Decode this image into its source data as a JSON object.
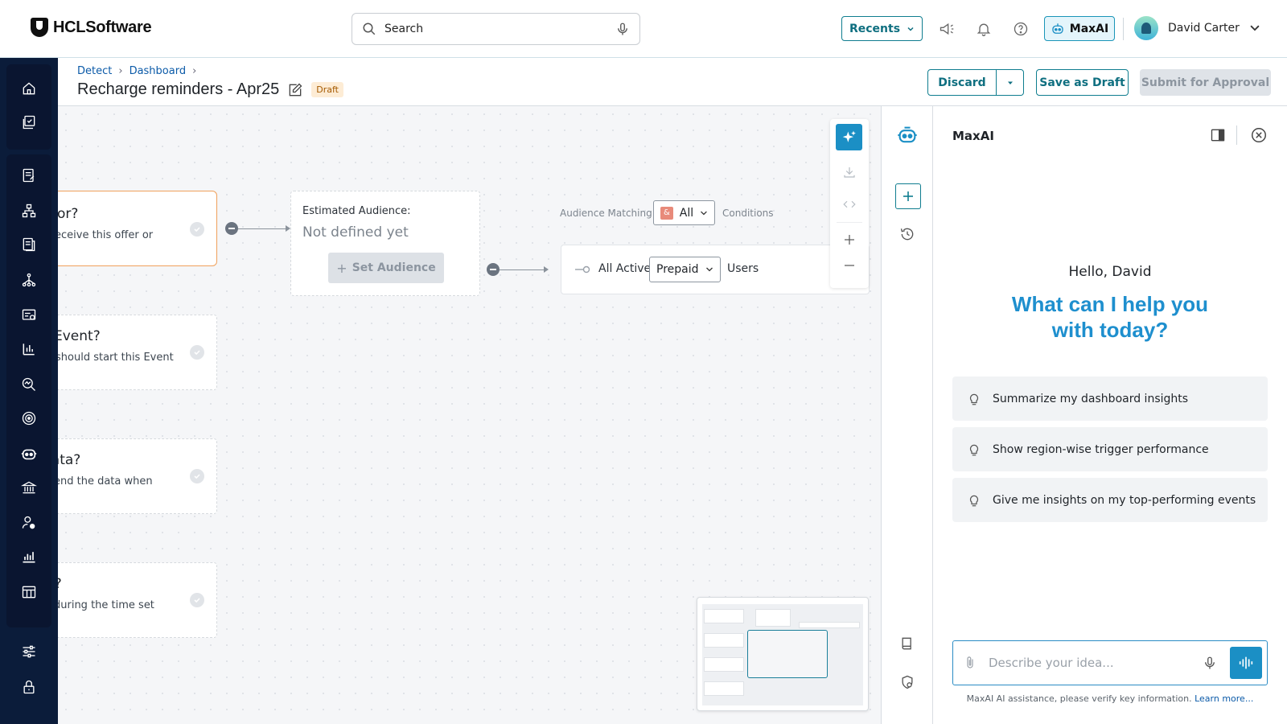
{
  "app": {
    "brand": "HCLSoftware"
  },
  "topbar": {
    "search_placeholder": "Search",
    "recents_label": "Recents",
    "maxai_label": "MaxAI",
    "user_name": "David Carter"
  },
  "breadcrumb": [
    "Detect",
    "Dashboard"
  ],
  "page": {
    "title": "Recharge reminders - Apr25",
    "status": "Draft"
  },
  "actions": {
    "discard": "Discard",
    "save_draft": "Save as Draft",
    "submit": "Submit for Approval"
  },
  "canvas": {
    "cards": [
      {
        "title": "or?",
        "subtitle": "eceive this offer or"
      },
      {
        "title": "Event?",
        "subtitle": "should start this Event"
      },
      {
        "title": " data?",
        "subtitle": "end the data when"
      },
      {
        "title": "n?",
        "subtitle": "during the time set"
      }
    ],
    "audience": {
      "label": "Estimated Audience:",
      "value": "Not defined yet",
      "button": "Set Audience"
    },
    "matching": {
      "label": "Audience Matching",
      "value": "All",
      "conditions": "Conditions"
    },
    "condition": {
      "prefix": "All Active",
      "value": "Prepaid",
      "suffix": "Users"
    }
  },
  "maxai": {
    "title": "MaxAI",
    "greeting": "Hello, David",
    "headline": "What can I help you with today?",
    "suggestions": [
      "Summarize my dashboard insights",
      "Show region-wise trigger performance",
      "Give me insights on my top-performing events"
    ],
    "prompt_placeholder": "Describe your idea...",
    "disclaimer": "MaxAI AI assistance, please verify key information.",
    "learn_more": "Learn more..."
  },
  "colors": {
    "accent": "#0f7d8f",
    "ai_blue": "#1b8fc5",
    "nav_bg": "#0b1c3a",
    "draft_bg": "#fdecd5",
    "active_border": "#f0a15c"
  }
}
